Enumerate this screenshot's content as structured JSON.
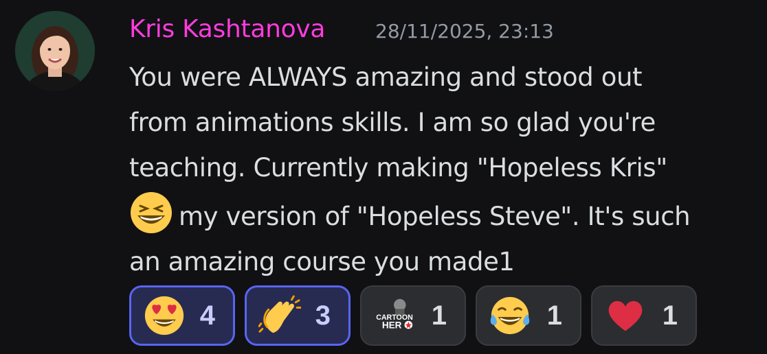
{
  "message": {
    "author": "Kris Kashtanova",
    "author_color": "#ff3cdd",
    "timestamp": "28/11/2025, 23:13",
    "content_lines": [
      "You were ALWAYS amazing and stood out",
      "from animations skills. I am so glad you're",
      "teaching. Currently making \"Hopeless Kris\"",
      "my version of \"Hopeless Steve\". It's such",
      "an amazing course you made1"
    ],
    "inline_emoji": "grinning-squinting-face-emoji"
  },
  "reactions": [
    {
      "emoji": "heart-eyes-emoji",
      "count": "4",
      "selected": true
    },
    {
      "emoji": "clapping-hands-emoji",
      "count": "3",
      "selected": true
    },
    {
      "emoji": "cartoon-hero-custom-emoji",
      "label": "CARTOON HERO",
      "count": "1",
      "selected": false
    },
    {
      "emoji": "tears-of-joy-emoji",
      "count": "1",
      "selected": false
    },
    {
      "emoji": "red-heart-emoji",
      "count": "1",
      "selected": false
    }
  ],
  "colors": {
    "background": "#111114",
    "text": "#dbdee1",
    "timestamp": "#949ba4",
    "reaction_selected_border": "#5865f2"
  }
}
